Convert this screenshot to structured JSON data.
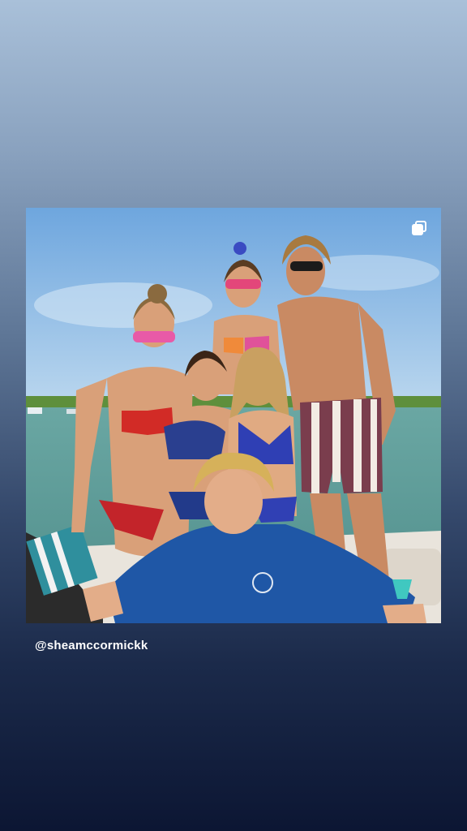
{
  "story": {
    "username": "@sheamccormickk"
  },
  "post": {
    "photo_subject": "group-photo-on-boat",
    "multi_post_icon": "carousel-icon"
  },
  "colors": {
    "bg_top": "#a9c0d9",
    "bg_bottom": "#0c1633",
    "sky": "#7fb3e0",
    "water": "#5f9e98",
    "text": "#ffffff"
  }
}
